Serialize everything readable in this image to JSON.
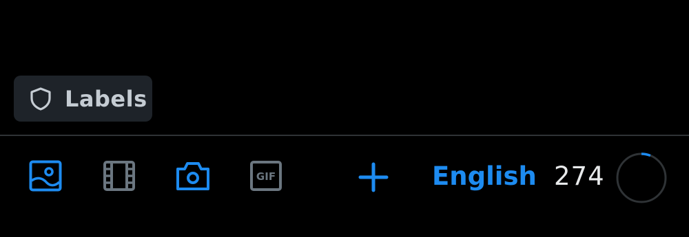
{
  "labels_button": {
    "label": "Labels",
    "icon": "shield-icon"
  },
  "toolbar": {
    "items": [
      {
        "name": "image-icon",
        "active": true
      },
      {
        "name": "video-icon",
        "active": false
      },
      {
        "name": "camera-icon",
        "active": true
      },
      {
        "name": "gif-icon",
        "active": false,
        "text": "GIF"
      },
      {
        "name": "add-icon",
        "active": true
      }
    ],
    "language": "English",
    "char_count": "274",
    "progress": 0.06
  },
  "colors": {
    "accent": "#1d8bf0",
    "muted": "#6b7680",
    "chip_bg": "#1e2329",
    "divider": "#2f3336"
  }
}
